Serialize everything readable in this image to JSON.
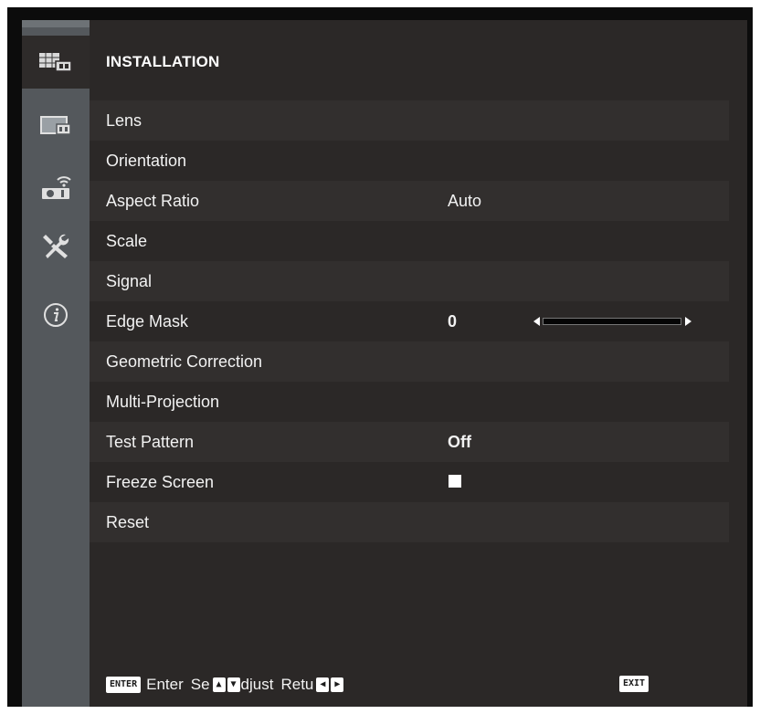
{
  "menu": {
    "title": "INSTALLATION",
    "items": [
      {
        "label": "Lens",
        "value": ""
      },
      {
        "label": "Orientation",
        "value": ""
      },
      {
        "label": "Aspect Ratio",
        "value": "Auto"
      },
      {
        "label": "Scale",
        "value": ""
      },
      {
        "label": "Signal",
        "value": ""
      },
      {
        "label": "Edge Mask",
        "value": "0"
      },
      {
        "label": "Geometric Correction",
        "value": ""
      },
      {
        "label": "Multi-Projection",
        "value": ""
      },
      {
        "label": "Test Pattern",
        "value": "Off"
      },
      {
        "label": "Freeze Screen",
        "value": ""
      },
      {
        "label": "Reset",
        "value": ""
      }
    ],
    "edge_mask_level": 0,
    "freeze_screen_checked": true
  },
  "sidebar": {
    "icons": [
      "installation-grid-icon",
      "display-icon",
      "projector-network-icon",
      "wrench-tools-icon",
      "info-icon"
    ],
    "active": "installation-grid-icon"
  },
  "footer": {
    "enter_key": "ENTER",
    "enter_text": "Enter",
    "select_text": "Se",
    "up_key": "▲",
    "down_key": "▼",
    "adjust_text": "djust",
    "return_text": "Retu",
    "left_key": "◀",
    "right_key": "▶",
    "exit_key": "EXIT"
  },
  "colors": {
    "background": "#2b2827",
    "sidebar": "#54585c",
    "text": "#f2f2f2"
  }
}
